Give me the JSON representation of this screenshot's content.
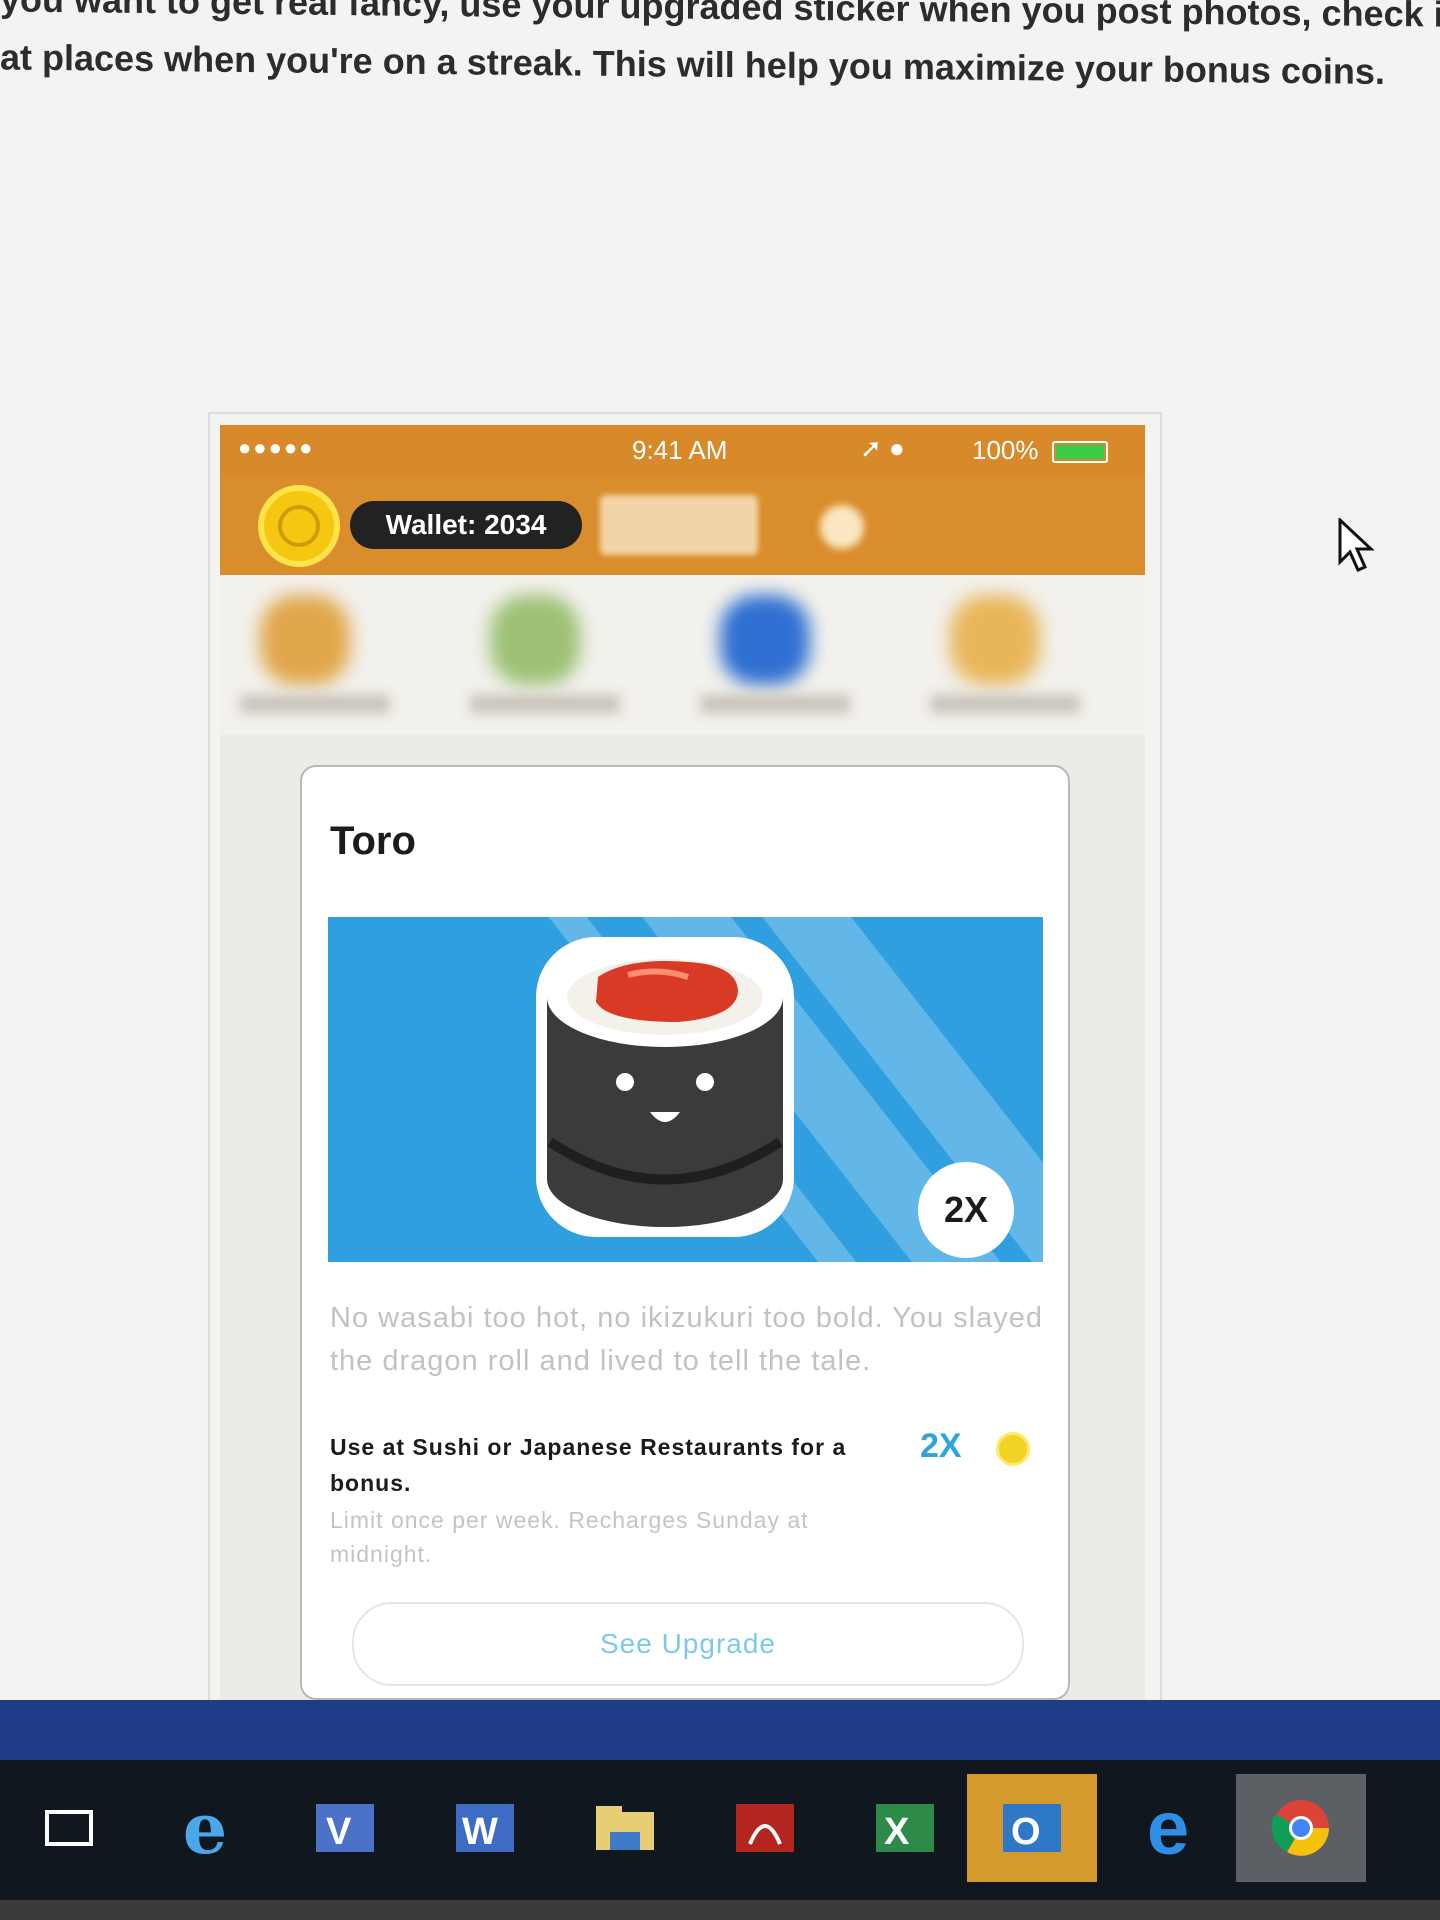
{
  "article": {
    "line1": "you want to get real fancy, use your upgraded sticker when you post photos, check in with friends,",
    "line2": "at places when you're on a streak. This will help you maximize your bonus coins."
  },
  "status_bar": {
    "signal": "●●●●●",
    "time": "9:41 AM",
    "battery": "100%"
  },
  "header": {
    "wallet_label": "Wallet: 2034"
  },
  "card": {
    "title": "Toro",
    "multiplier_badge": "2X",
    "description": "No wasabi too hot, no ikizukuri too bold. You slayed the dragon roll and lived to tell the tale.",
    "use_text": "Use at Sushi or Japanese Restaurants for a bonus.",
    "bonus_multiplier": "2X",
    "limit_text": "Limit once per week. Recharges Sunday at midnight.",
    "upgrade_button": "See Upgrade"
  },
  "taskbar": {
    "items": [
      {
        "name": "task-view-icon",
        "glyph": "[ ]"
      },
      {
        "name": "internet-explorer-icon",
        "glyph": "e"
      },
      {
        "name": "visio-icon",
        "glyph": "V"
      },
      {
        "name": "word-icon",
        "glyph": "W"
      },
      {
        "name": "file-explorer-icon",
        "glyph": ""
      },
      {
        "name": "acrobat-icon",
        "glyph": ""
      },
      {
        "name": "excel-icon",
        "glyph": "X"
      },
      {
        "name": "outlook-icon",
        "glyph": "O"
      },
      {
        "name": "edge-icon",
        "glyph": "e"
      },
      {
        "name": "chrome-icon",
        "glyph": ""
      }
    ]
  },
  "colors": {
    "header_orange": "#d98d2c",
    "hero_blue": "#2f9fe0",
    "accent_blue": "#2fa4d8",
    "coin_yellow": "#f5c711",
    "taskbar_blue": "#1f3c86"
  }
}
